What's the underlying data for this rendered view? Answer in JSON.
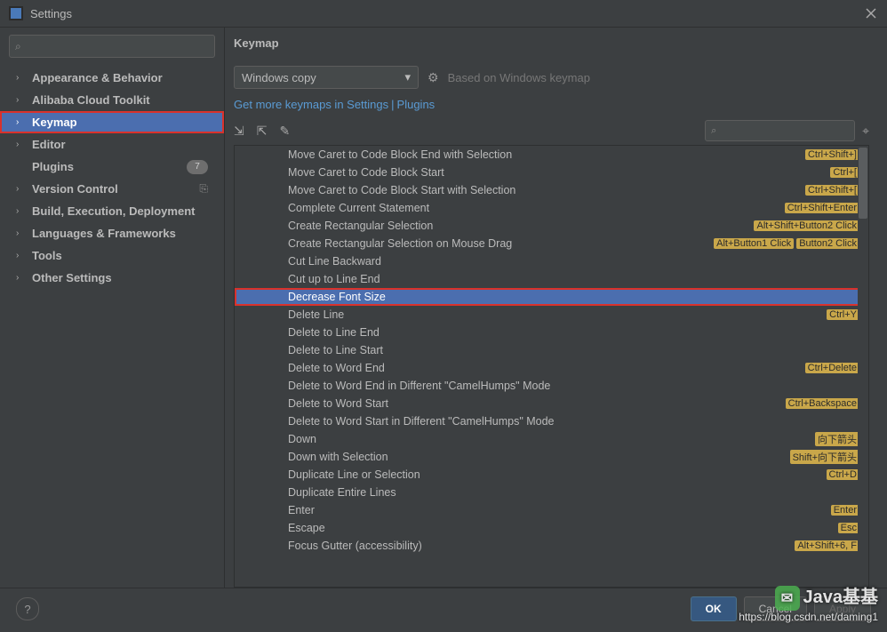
{
  "titlebar": {
    "title": "Settings"
  },
  "sidebar": {
    "search_placeholder": "",
    "items": [
      {
        "label": "Appearance & Behavior",
        "chev": true
      },
      {
        "label": "Alibaba Cloud Toolkit",
        "chev": true
      },
      {
        "label": "Keymap",
        "chev": true,
        "selected": true
      },
      {
        "label": "Editor",
        "chev": true
      },
      {
        "label": "Plugins",
        "chev": false,
        "badge": "7"
      },
      {
        "label": "Version Control",
        "chev": true,
        "copy": true
      },
      {
        "label": "Build, Execution, Deployment",
        "chev": true
      },
      {
        "label": "Languages & Frameworks",
        "chev": true
      },
      {
        "label": "Tools",
        "chev": true
      },
      {
        "label": "Other Settings",
        "chev": true
      }
    ]
  },
  "main": {
    "title": "Keymap",
    "dropdown": "Windows copy",
    "based_on": "Based on Windows keymap",
    "link1": "Get more keymaps in Settings",
    "link2": "Plugins"
  },
  "actions": [
    {
      "name": "Move Caret to Code Block End with Selection",
      "shortcuts": [
        "Ctrl+Shift+]"
      ]
    },
    {
      "name": "Move Caret to Code Block Start",
      "shortcuts": [
        "Ctrl+["
      ]
    },
    {
      "name": "Move Caret to Code Block Start with Selection",
      "shortcuts": [
        "Ctrl+Shift+["
      ]
    },
    {
      "name": "Complete Current Statement",
      "shortcuts": [
        "Ctrl+Shift+Enter"
      ]
    },
    {
      "name": "Create Rectangular Selection",
      "shortcuts": [
        "Alt+Shift+Button2 Click"
      ]
    },
    {
      "name": "Create Rectangular Selection on Mouse Drag",
      "shortcuts": [
        "Alt+Button1 Click",
        "Button2 Click"
      ]
    },
    {
      "name": "Cut Line Backward",
      "shortcuts": []
    },
    {
      "name": "Cut up to Line End",
      "shortcuts": []
    },
    {
      "name": "Decrease Font Size",
      "shortcuts": [],
      "selected": true
    },
    {
      "name": "Delete Line",
      "shortcuts": [
        "Ctrl+Y"
      ]
    },
    {
      "name": "Delete to Line End",
      "shortcuts": []
    },
    {
      "name": "Delete to Line Start",
      "shortcuts": []
    },
    {
      "name": "Delete to Word End",
      "shortcuts": [
        "Ctrl+Delete"
      ]
    },
    {
      "name": "Delete to Word End in Different \"CamelHumps\" Mode",
      "shortcuts": []
    },
    {
      "name": "Delete to Word Start",
      "shortcuts": [
        "Ctrl+Backspace"
      ]
    },
    {
      "name": "Delete to Word Start in Different \"CamelHumps\" Mode",
      "shortcuts": []
    },
    {
      "name": "Down",
      "shortcuts": [
        "向下箭头"
      ]
    },
    {
      "name": "Down with Selection",
      "shortcuts": [
        "Shift+向下箭头"
      ]
    },
    {
      "name": "Duplicate Line or Selection",
      "shortcuts": [
        "Ctrl+D"
      ]
    },
    {
      "name": "Duplicate Entire Lines",
      "shortcuts": []
    },
    {
      "name": "Enter",
      "shortcuts": [
        "Enter"
      ]
    },
    {
      "name": "Escape",
      "shortcuts": [
        "Esc"
      ]
    },
    {
      "name": "Focus Gutter (accessibility)",
      "shortcuts": [
        "Alt+Shift+6, F"
      ]
    }
  ],
  "footer": {
    "ok": "OK",
    "cancel": "Cancel",
    "apply": "Apply"
  },
  "watermark": {
    "t1": "Java基基",
    "t2": "https://blog.csdn.net/daming1"
  }
}
